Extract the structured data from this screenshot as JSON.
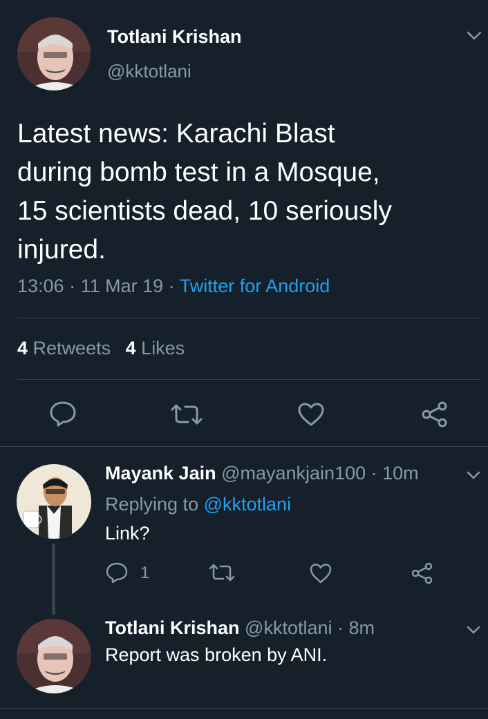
{
  "tweet": {
    "author_name": "Totlani Krishan",
    "author_handle": "@kktotlani",
    "text_lines": [
      "Latest news: Karachi Blast",
      "during bomb test in a Mosque,",
      "15 scientists dead, 10 seriously",
      "injured."
    ],
    "time": "13:06",
    "date": "11 Mar 19",
    "separator": "·",
    "source": "Twitter for Android",
    "retweets_count": "4",
    "retweets_label": "Retweets",
    "likes_count": "4",
    "likes_label": "Likes"
  },
  "replies": [
    {
      "name": "Mayank Jain",
      "handle": "@mayankjain100",
      "time": "· 10m",
      "replying_prefix": "Replying to",
      "replying_handle": "@kktotlani",
      "text": "Link?",
      "reply_count": "1"
    },
    {
      "name": "Totlani Krishan",
      "handle": "@kktotlani",
      "time": "· 8m",
      "text": "Report was broken by ANI."
    }
  ],
  "icons": [
    "chevron-down-icon",
    "reply-icon",
    "retweet-icon",
    "like-icon",
    "share-icon"
  ],
  "colors": {
    "background": "#15202b",
    "accent": "#1da1f2",
    "secondary": "#8899a6",
    "divider": "#38444d"
  }
}
